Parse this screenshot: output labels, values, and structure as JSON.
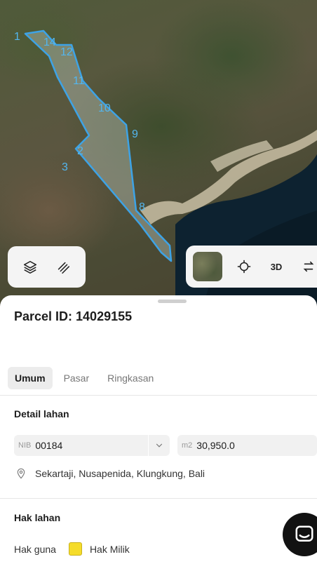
{
  "map": {
    "vertex_labels": [
      "1",
      "14",
      "12",
      "11",
      "10",
      "9",
      "2",
      "3",
      "8"
    ],
    "controls_left": [
      {
        "icon": "layers-icon"
      },
      {
        "icon": "measure-icon"
      }
    ],
    "controls_right": {
      "thumbnail": "satellite-thumbnail",
      "locate_icon": "crosshair-icon",
      "label_3d": "3D",
      "extra_icon": "transfer-icon"
    }
  },
  "parcel": {
    "title": "Parcel ID: 14029155"
  },
  "tabs": [
    "Umum",
    "Pasar",
    "Ringkasan"
  ],
  "detail": {
    "heading": "Detail lahan",
    "nib_prefix": "NIB",
    "nib_value": "00184",
    "area_prefix": "m2",
    "area_value": "30,950.0",
    "address": "Sekartaji, Nusapenida, Klungkung, Bali"
  },
  "rights": {
    "heading": "Hak lahan",
    "label": "Hak guna",
    "value": "Hak Milik",
    "color": "#f5dc2a"
  },
  "colors": {
    "parcel_outline": "#3da3e6",
    "label": "#53b6ef"
  }
}
